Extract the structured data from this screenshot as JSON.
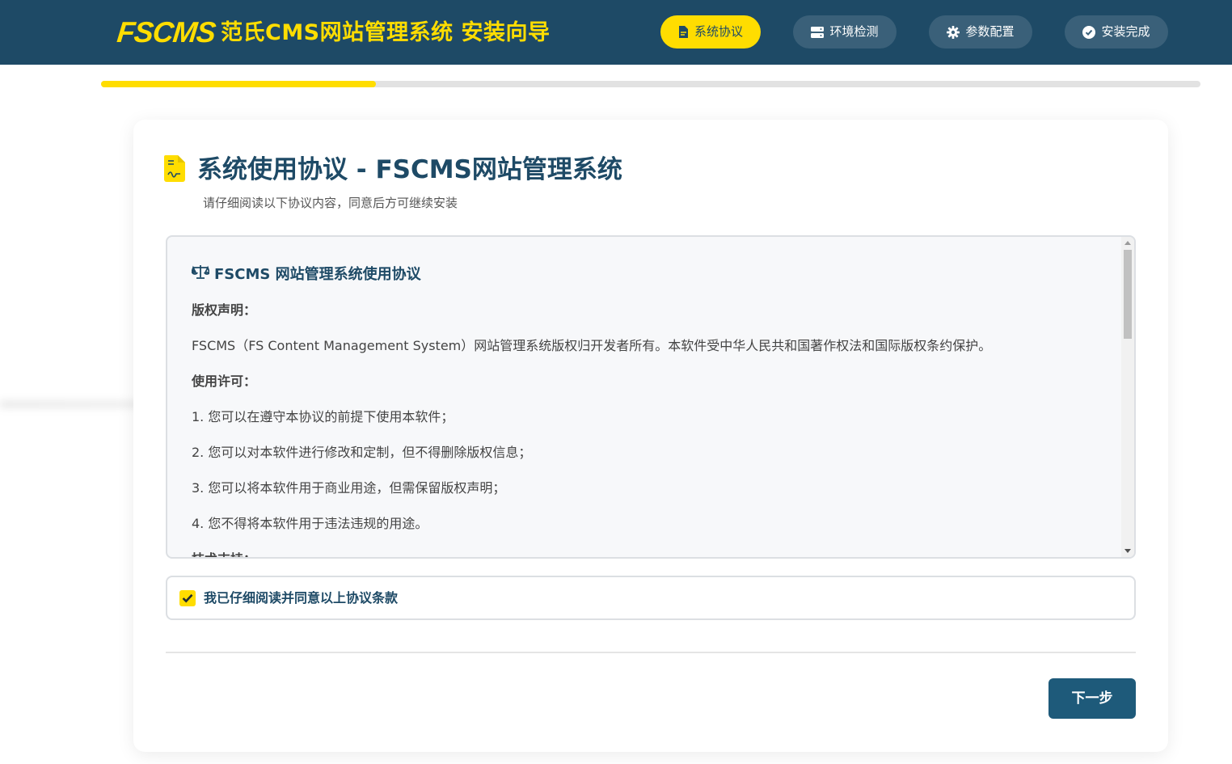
{
  "header": {
    "logo_text": "FSCMS",
    "title": "范氏CMS网站管理系统 安装向导"
  },
  "steps": [
    {
      "label": "系统协议",
      "icon": "file-contract-icon",
      "active": true
    },
    {
      "label": "环境检测",
      "icon": "server-icon",
      "active": false
    },
    {
      "label": "参数配置",
      "icon": "gear-icon",
      "active": false
    },
    {
      "label": "安装完成",
      "icon": "check-circle-icon",
      "active": false
    }
  ],
  "progress": {
    "percent": 25
  },
  "card": {
    "title": "系统使用协议 - FSCMS网站管理系统",
    "subtitle": "请仔细阅读以下协议内容，同意后方可继续安装"
  },
  "agreement": {
    "heading": "FSCMS 网站管理系统使用协议",
    "copyright_title": "版权声明：",
    "copyright_text": "FSCMS（FS Content Management System）网站管理系统版权归开发者所有。本软件受中华人民共和国著作权法和国际版权条约保护。",
    "license_title": "使用许可：",
    "items": [
      "1. 您可以在遵守本协议的前提下使用本软件；",
      "2. 您可以对本软件进行修改和定制，但不得删除版权信息；",
      "3. 您可以将本软件用于商业用途，但需保留版权声明；",
      "4. 您不得将本软件用于违法违规的用途。"
    ],
    "support_title": "技术支持："
  },
  "agree": {
    "label": "我已仔细阅读并同意以上协议条款",
    "checked": true
  },
  "buttons": {
    "next": "下一步"
  },
  "colors": {
    "primary": "#1e4a66",
    "accent": "#ffdd00",
    "button": "#1e5a7a"
  }
}
